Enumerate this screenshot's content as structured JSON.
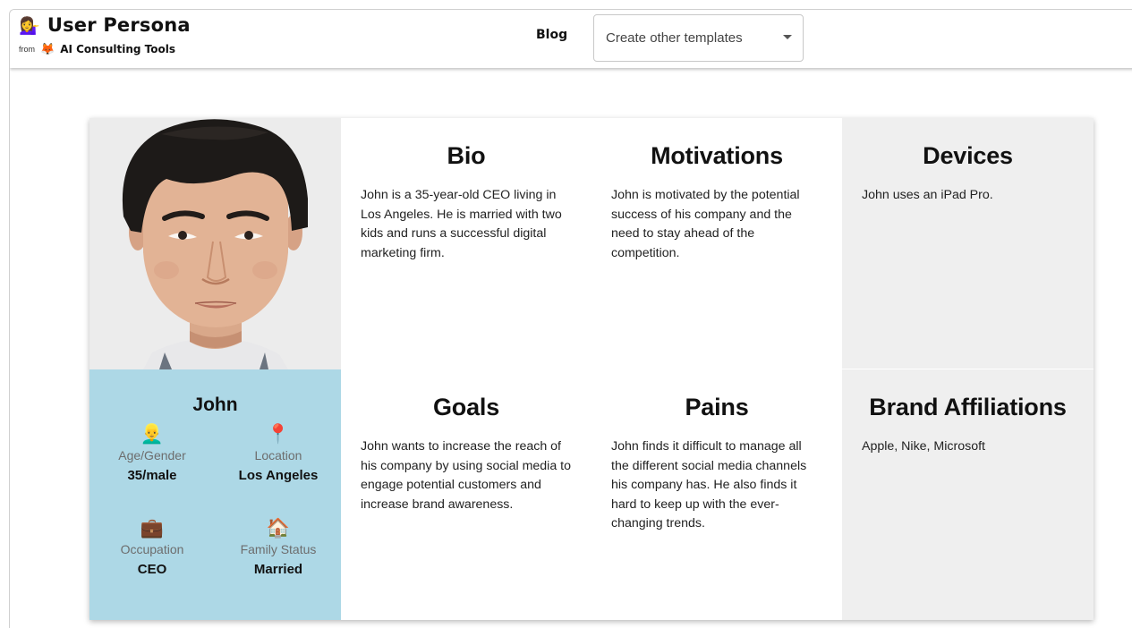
{
  "header": {
    "app_title": "User Persona",
    "app_emoji": "💁‍♀️",
    "from_label": "from",
    "org_icon": "🦊",
    "org_name": "AI Consulting Tools",
    "blog_link": "Blog",
    "template_select": {
      "selected": "Create other templates",
      "icon": "caret-down"
    }
  },
  "persona": {
    "name": "John",
    "photo": "portrait-photo",
    "stats": [
      {
        "emoji": "👱‍♂️",
        "label": "Age/Gender",
        "value": "35/male"
      },
      {
        "emoji": "📍",
        "label": "Location",
        "value": "Los Angeles"
      },
      {
        "emoji": "💼",
        "label": "Occupation",
        "value": "CEO"
      },
      {
        "emoji": "🏠",
        "label": "Family Status",
        "value": "Married"
      }
    ]
  },
  "sections": {
    "bio": {
      "title": "Bio",
      "text": "John is a 35-year-old CEO living in Los Angeles. He is married with two kids and runs a successful digital marketing firm."
    },
    "motivations": {
      "title": "Motivations",
      "text": "John is motivated by the potential success of his company and the need to stay ahead of the competition."
    },
    "devices": {
      "title": "Devices",
      "text": "John uses an iPad Pro."
    },
    "goals": {
      "title": "Goals",
      "text": "John wants to increase the reach of his company by using social media to engage potential customers and increase brand awareness."
    },
    "pains": {
      "title": "Pains",
      "text": "John finds it difficult to manage all the different social media channels his company has. He also finds it hard to keep up with the ever-changing trends."
    },
    "brand_affiliations": {
      "title": "Brand Affiliations",
      "text": "Apple, Nike, Microsoft"
    }
  },
  "colors": {
    "profile_bg": "#add8e6",
    "gray_bg": "#efefef",
    "text": "#111111",
    "muted": "#6d6d6d"
  }
}
